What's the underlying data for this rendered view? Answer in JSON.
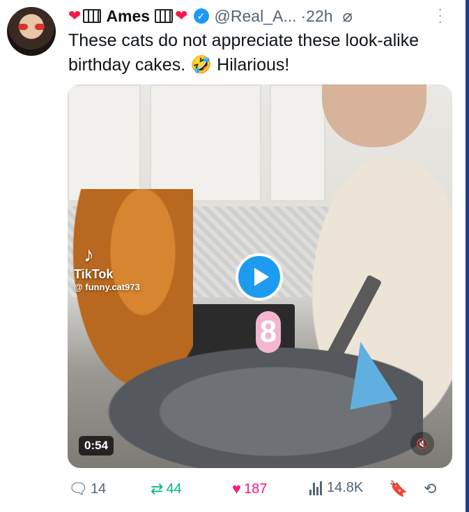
{
  "author": {
    "emoji_prefix": "❤",
    "name": "Ames",
    "emoji_suffix": "❤",
    "handle": "@Real_A...",
    "time": "·22h"
  },
  "tweet": {
    "text": "These cats do not appreciate  these  look-alike birthday cakes.   🤣 Hilarious!"
  },
  "media": {
    "watermark_brand": "TikTok",
    "watermark_user": "@ funny.cat973",
    "candle": "8",
    "duration": "0:54"
  },
  "actions": {
    "replies": "14",
    "reposts": "44",
    "likes": "187",
    "views": "14.8K"
  },
  "icons": {
    "reply": "reply-icon",
    "repost": "repost-icon",
    "like": "heart-icon",
    "views": "views-icon",
    "bookmark": "bookmark-icon",
    "share": "share-icon",
    "verified": "verified-badge-icon",
    "mute": "muted-speaker-icon",
    "play": "play-icon"
  },
  "colors": {
    "accent": "#1d9bf0",
    "like": "#f91880",
    "repost": "#00ba7c",
    "muted_text": "#536471"
  }
}
